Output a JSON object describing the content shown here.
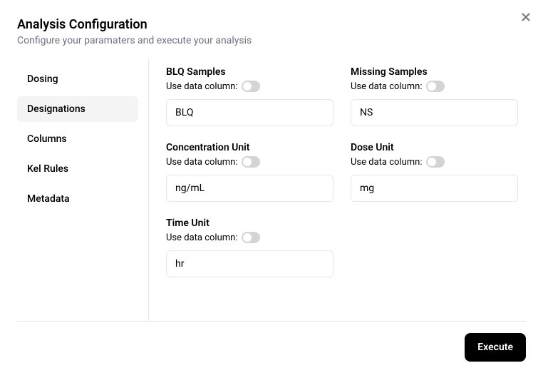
{
  "header": {
    "title": "Analysis Configuration",
    "subtitle": "Configure your paramaters and execute your analysis"
  },
  "sidebar": {
    "items": [
      {
        "label": "Dosing",
        "active": false
      },
      {
        "label": "Designations",
        "active": true
      },
      {
        "label": "Columns",
        "active": false
      },
      {
        "label": "Kel Rules",
        "active": false
      },
      {
        "label": "Metadata",
        "active": false
      }
    ]
  },
  "fields": {
    "blq": {
      "label": "BLQ Samples",
      "toggle_label": "Use data column:",
      "toggle_on": false,
      "value": "BLQ"
    },
    "missing": {
      "label": "Missing Samples",
      "toggle_label": "Use data column:",
      "toggle_on": false,
      "value": "NS"
    },
    "conc_unit": {
      "label": "Concentration Unit",
      "toggle_label": "Use data column:",
      "toggle_on": false,
      "value": "ng/mL"
    },
    "dose_unit": {
      "label": "Dose Unit",
      "toggle_label": "Use data column:",
      "toggle_on": false,
      "value": "mg"
    },
    "time_unit": {
      "label": "Time Unit",
      "toggle_label": "Use data column:",
      "toggle_on": false,
      "value": "hr"
    }
  },
  "footer": {
    "execute_label": "Execute"
  }
}
